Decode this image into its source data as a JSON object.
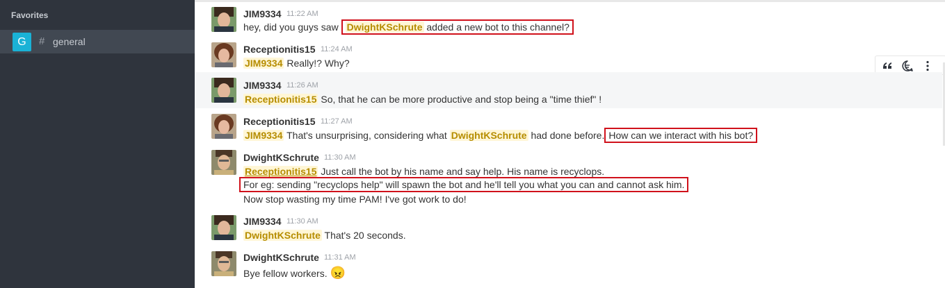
{
  "sidebar": {
    "favorites_title": "Favorites",
    "channel": {
      "avatar_letter": "G",
      "hash": "#",
      "name": "general"
    }
  },
  "message_actions": [
    "quote-icon",
    "reply-in-thread-icon",
    "more-icon"
  ],
  "messages": [
    {
      "user": "JIM9334",
      "time": "11:22 AM",
      "avatar": "jim",
      "text_before": "hey, did you guys saw",
      "mention": "DwightKSchrute",
      "text_after": "added a new bot to this channel?"
    },
    {
      "user": "Receptionitis15",
      "time": "11:24 AM",
      "avatar": "pam",
      "mention": "JIM9334",
      "text_after": "Really!? Why?"
    },
    {
      "user": "JIM9334",
      "time": "11:26 AM",
      "avatar": "jim",
      "mention": "Receptionitis15",
      "text_after": "So, that he can be more productive and stop being a \"time thief\" !"
    },
    {
      "user": "Receptionitis15",
      "time": "11:27 AM",
      "avatar": "pam",
      "mention": "JIM9334",
      "text_mid": "That's unsurprising, considering what",
      "mention2": "DwightKSchrute",
      "text_mid2": "had done before.",
      "boxed": "How can we interact with his bot?"
    },
    {
      "user": "DwightKSchrute",
      "time": "11:30 AM",
      "avatar": "dwight",
      "mention": "Receptionitis15",
      "text_after": "Just call the bot by his name and say help. His name is recyclops.",
      "line2": "For eg: sending \"recyclops help\" will spawn the bot and he'll tell you what you can and cannot ask him.",
      "line3": "Now stop wasting my time PAM! I've got work to do!"
    },
    {
      "user": "JIM9334",
      "time": "11:30 AM",
      "avatar": "jim",
      "mention": "DwightKSchrute",
      "text_after": "That's 20 seconds."
    },
    {
      "user": "DwightKSchrute",
      "time": "11:31 AM",
      "avatar": "dwight",
      "text_after": "Bye fellow workers.",
      "emoji": "😠"
    }
  ],
  "colors": {
    "sidebar": "#2f343d",
    "mention_bg": "#fff6d6",
    "mention_text": "#b68d00",
    "highlight_box": "#d0111b"
  }
}
